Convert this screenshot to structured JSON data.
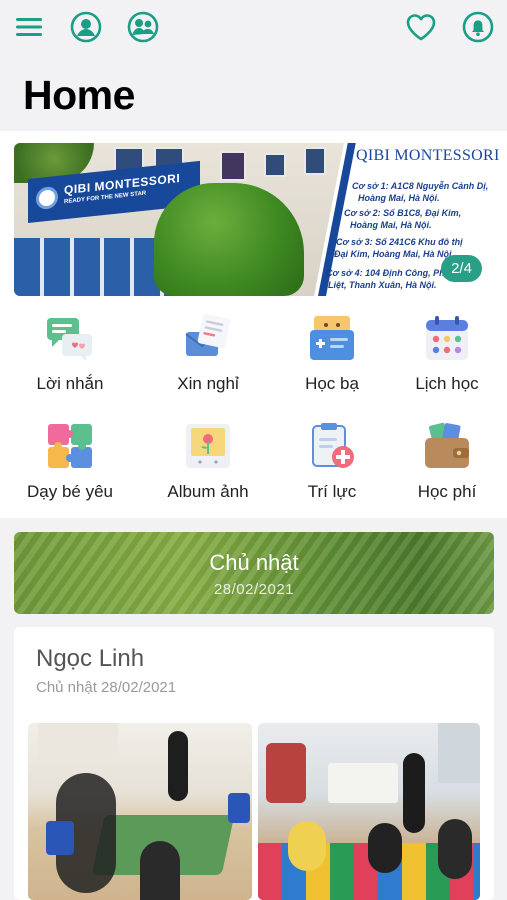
{
  "header": {
    "title": "Home",
    "icons": [
      "menu-icon",
      "user-profile-icon",
      "children-icon",
      "heart-icon",
      "bell-icon"
    ],
    "accent_color": "#1a9e86"
  },
  "banner": {
    "brand": "QIBI MONTESSORI",
    "sign_text": "QIBI MONTESSORI",
    "sign_sub": "READY FOR THE NEW STAR",
    "addresses": [
      "Cơ sở 1: A1C8 Nguyễn Cảnh Dị,",
      "Hoàng Mai, Hà Nội.",
      "Cơ sở 2: Số B1C8, Đại Kim,",
      "Hoàng Mai, Hà Nội.",
      "Cơ sở 3: Số 241C6 Khu đô thị",
      "Đại Kim, Hoàng Mai, Hà Nội.",
      "Cơ sở 4: 104 Định Công, Phương",
      "Liệt, Thanh Xuân, Hà Nội."
    ],
    "counter": "2/4"
  },
  "menu": [
    {
      "label": "Lời nhắn",
      "icon": "message-bubbles-icon"
    },
    {
      "label": "Xin nghỉ",
      "icon": "leave-letter-icon"
    },
    {
      "label": "Học bạ",
      "icon": "report-card-icon"
    },
    {
      "label": "Lịch học",
      "icon": "calendar-icon"
    },
    {
      "label": "Dạy bé yêu",
      "icon": "puzzle-icon"
    },
    {
      "label": "Album ảnh",
      "icon": "photo-album-icon"
    },
    {
      "label": "Trí lực",
      "icon": "health-clipboard-icon"
    },
    {
      "label": "Học phí",
      "icon": "wallet-icon"
    }
  ],
  "date_banner": {
    "day": "Chủ nhật",
    "date": "28/02/2021"
  },
  "post": {
    "name": "Ngọc Linh",
    "date": "Chủ nhật 28/02/2021"
  }
}
